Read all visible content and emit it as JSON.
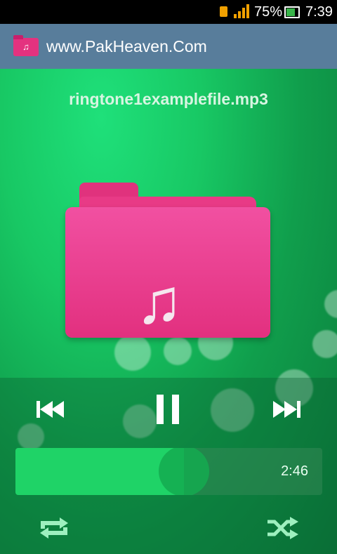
{
  "status_bar": {
    "battery_percent": "75%",
    "time": "7:39"
  },
  "action_bar": {
    "title": "www.PakHeaven.Com",
    "icon": "music-folder-icon"
  },
  "player": {
    "track_name": "ringtone1examplefile.mp3",
    "duration": "2:46",
    "progress": 0.55,
    "controls": {
      "previous": "skip-previous-icon",
      "pause": "pause-icon",
      "next": "skip-next-icon",
      "repeat": "repeat-icon",
      "shuffle": "shuffle-icon"
    }
  },
  "colors": {
    "accent_pink": "#e4327f",
    "action_bar": "#587d9b",
    "progress_fill": "#1fd367"
  }
}
